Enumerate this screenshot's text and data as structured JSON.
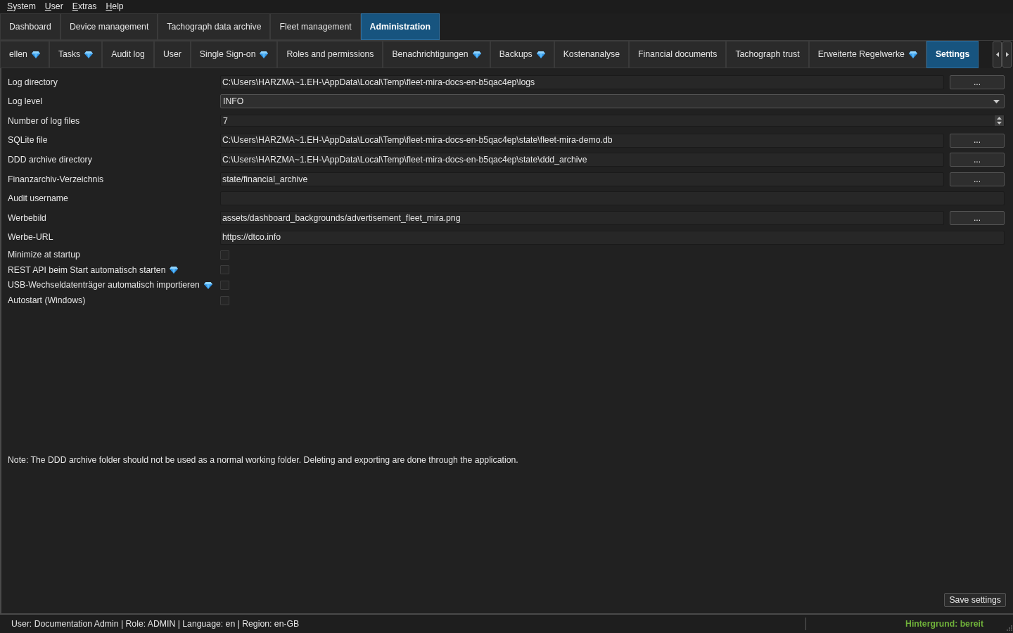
{
  "menu_bar": [
    "System",
    "User",
    "Extras",
    "Help"
  ],
  "main_tabs": [
    {
      "label": "Dashboard",
      "selected": false
    },
    {
      "label": "Device management",
      "selected": false
    },
    {
      "label": "Tachograph data archive",
      "selected": false
    },
    {
      "label": "Fleet management",
      "selected": false
    },
    {
      "label": "Administration",
      "selected": true
    }
  ],
  "sub_tabs": [
    {
      "label": "ellen",
      "selected": false,
      "diamond": true
    },
    {
      "label": "Tasks",
      "selected": false,
      "diamond": true
    },
    {
      "label": "Audit log",
      "selected": false,
      "diamond": false
    },
    {
      "label": "User",
      "selected": false,
      "diamond": false
    },
    {
      "label": "Single Sign-on",
      "selected": false,
      "diamond": true
    },
    {
      "label": "Roles and permissions",
      "selected": false,
      "diamond": false
    },
    {
      "label": "Benachrichtigungen",
      "selected": false,
      "diamond": true
    },
    {
      "label": "Backups",
      "selected": false,
      "diamond": true
    },
    {
      "label": "Kostenanalyse",
      "selected": false,
      "diamond": false
    },
    {
      "label": "Financial documents",
      "selected": false,
      "diamond": false
    },
    {
      "label": "Tachograph trust",
      "selected": false,
      "diamond": false
    },
    {
      "label": "Erweiterte Regelwerke",
      "selected": false,
      "diamond": true
    },
    {
      "label": "Settings",
      "selected": true,
      "diamond": false
    }
  ],
  "settings": [
    {
      "kind": "path",
      "label": "Log directory",
      "value": "C:\\Users\\HARZMA~1.EH-\\AppData\\Local\\Temp\\fleet-mira-docs-en-b5qac4ep\\logs",
      "browse_button": "..."
    },
    {
      "kind": "select",
      "label": "Log level",
      "value": "INFO"
    },
    {
      "kind": "number",
      "label": "Number of log files",
      "value": "7"
    },
    {
      "kind": "path",
      "label": "SQLite file",
      "value": "C:\\Users\\HARZMA~1.EH-\\AppData\\Local\\Temp\\fleet-mira-docs-en-b5qac4ep\\state\\fleet-mira-demo.db",
      "browse_button": "..."
    },
    {
      "kind": "path",
      "label": "DDD archive directory",
      "value": "C:\\Users\\HARZMA~1.EH-\\AppData\\Local\\Temp\\fleet-mira-docs-en-b5qac4ep\\state\\ddd_archive",
      "browse_button": "..."
    },
    {
      "kind": "path",
      "label": "Finanzarchiv-Verzeichnis",
      "value": "state/financial_archive",
      "browse_button": "..."
    },
    {
      "kind": "text",
      "label": "Audit username"
    },
    {
      "kind": "path",
      "label": "Werbebild",
      "value": "assets/dashboard_backgrounds/advertisement_fleet_mira.png",
      "browse_button": "..."
    },
    {
      "kind": "text",
      "label": "Werbe-URL",
      "value": "https://dtco.info"
    },
    {
      "kind": "checkbox",
      "label": "Minimize at startup",
      "checked": false,
      "diamond": false
    },
    {
      "kind": "checkbox",
      "label": "REST API beim Start automatisch starten",
      "checked": false,
      "diamond": true
    },
    {
      "kind": "checkbox",
      "label": "USB-Wechseldatenträger automatisch importieren",
      "checked": false,
      "diamond": true
    },
    {
      "kind": "checkbox",
      "label": "Autostart (Windows)",
      "checked": false,
      "diamond": false
    }
  ],
  "note": "Note: The DDD archive folder should not be used as a normal working folder. Deleting and exporting are done through the application.",
  "save_button": "Save settings",
  "status_bar": {
    "user_info": "User: Documentation Admin | Role: ADMIN | Language: en | Region: en-GB",
    "background_status": "Hintergrund: bereit"
  }
}
